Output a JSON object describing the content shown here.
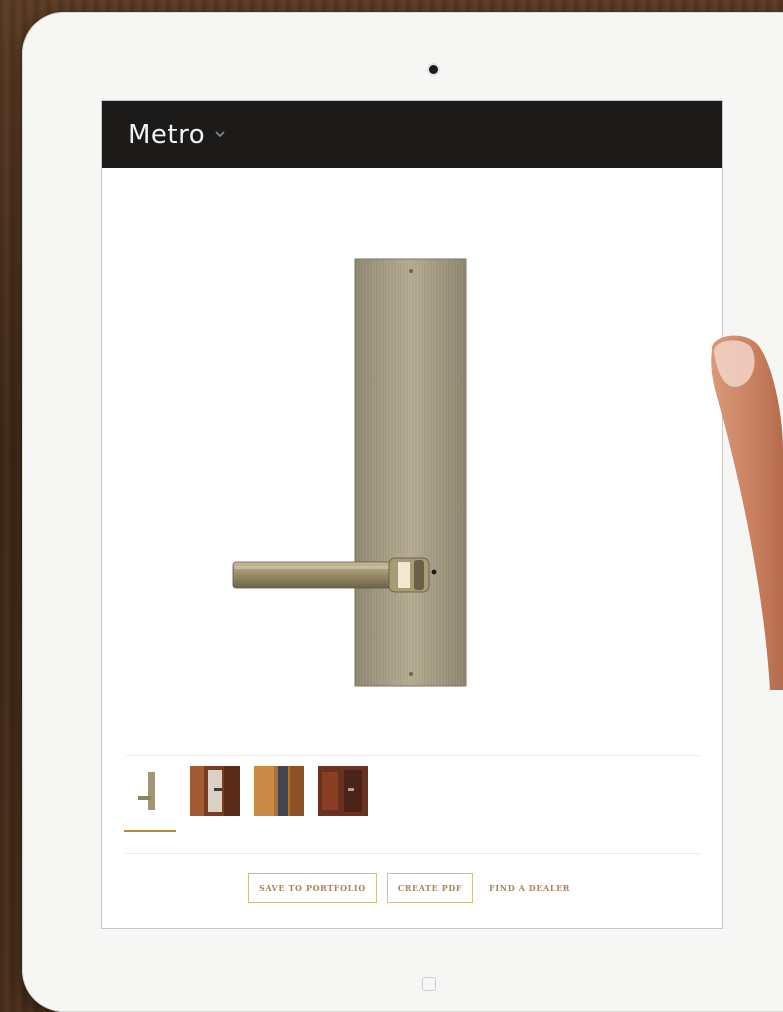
{
  "app": {
    "title": "Metro"
  },
  "icons": {
    "title_dropdown": "chevron-down-icon",
    "camera": "camera-icon",
    "home": "home-button-icon"
  },
  "product": {
    "image": "lever-handle-on-long-backplate",
    "finish_color": "#a79c82"
  },
  "gallery": {
    "thumbnails": [
      {
        "name": "lever-handle-product",
        "selected": true
      },
      {
        "name": "door-installation-photo-1",
        "selected": false
      },
      {
        "name": "door-installation-photo-2",
        "selected": false
      },
      {
        "name": "door-installation-photo-3",
        "selected": false
      }
    ],
    "selected_index": 0
  },
  "actions": {
    "save_to_portfolio": "SAVE TO PORTFOLIO",
    "create_pdf": "CREATE PDF",
    "find_dealer": "FIND A DEALER"
  },
  "colors": {
    "header_bg": "#1c1b19",
    "accent": "#a98557",
    "button_border": "#d6bc92",
    "selection_underline": "#b8893f"
  }
}
